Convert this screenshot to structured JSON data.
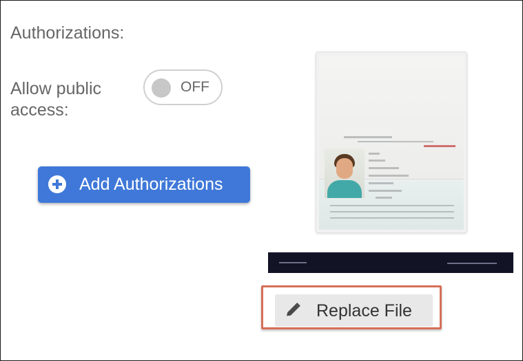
{
  "authorizations": {
    "title": "Authorizations:",
    "public_access_label": "Allow public access:",
    "toggle_state": "OFF",
    "add_button_label": "Add Authorizations"
  },
  "document": {
    "replace_button_label": "Replace File",
    "replace_icon": "pencil-icon",
    "add_icon": "plus-circle-icon"
  },
  "colors": {
    "primary": "#3f78d8",
    "highlight_border": "#d66f59",
    "banner": "#121425"
  }
}
